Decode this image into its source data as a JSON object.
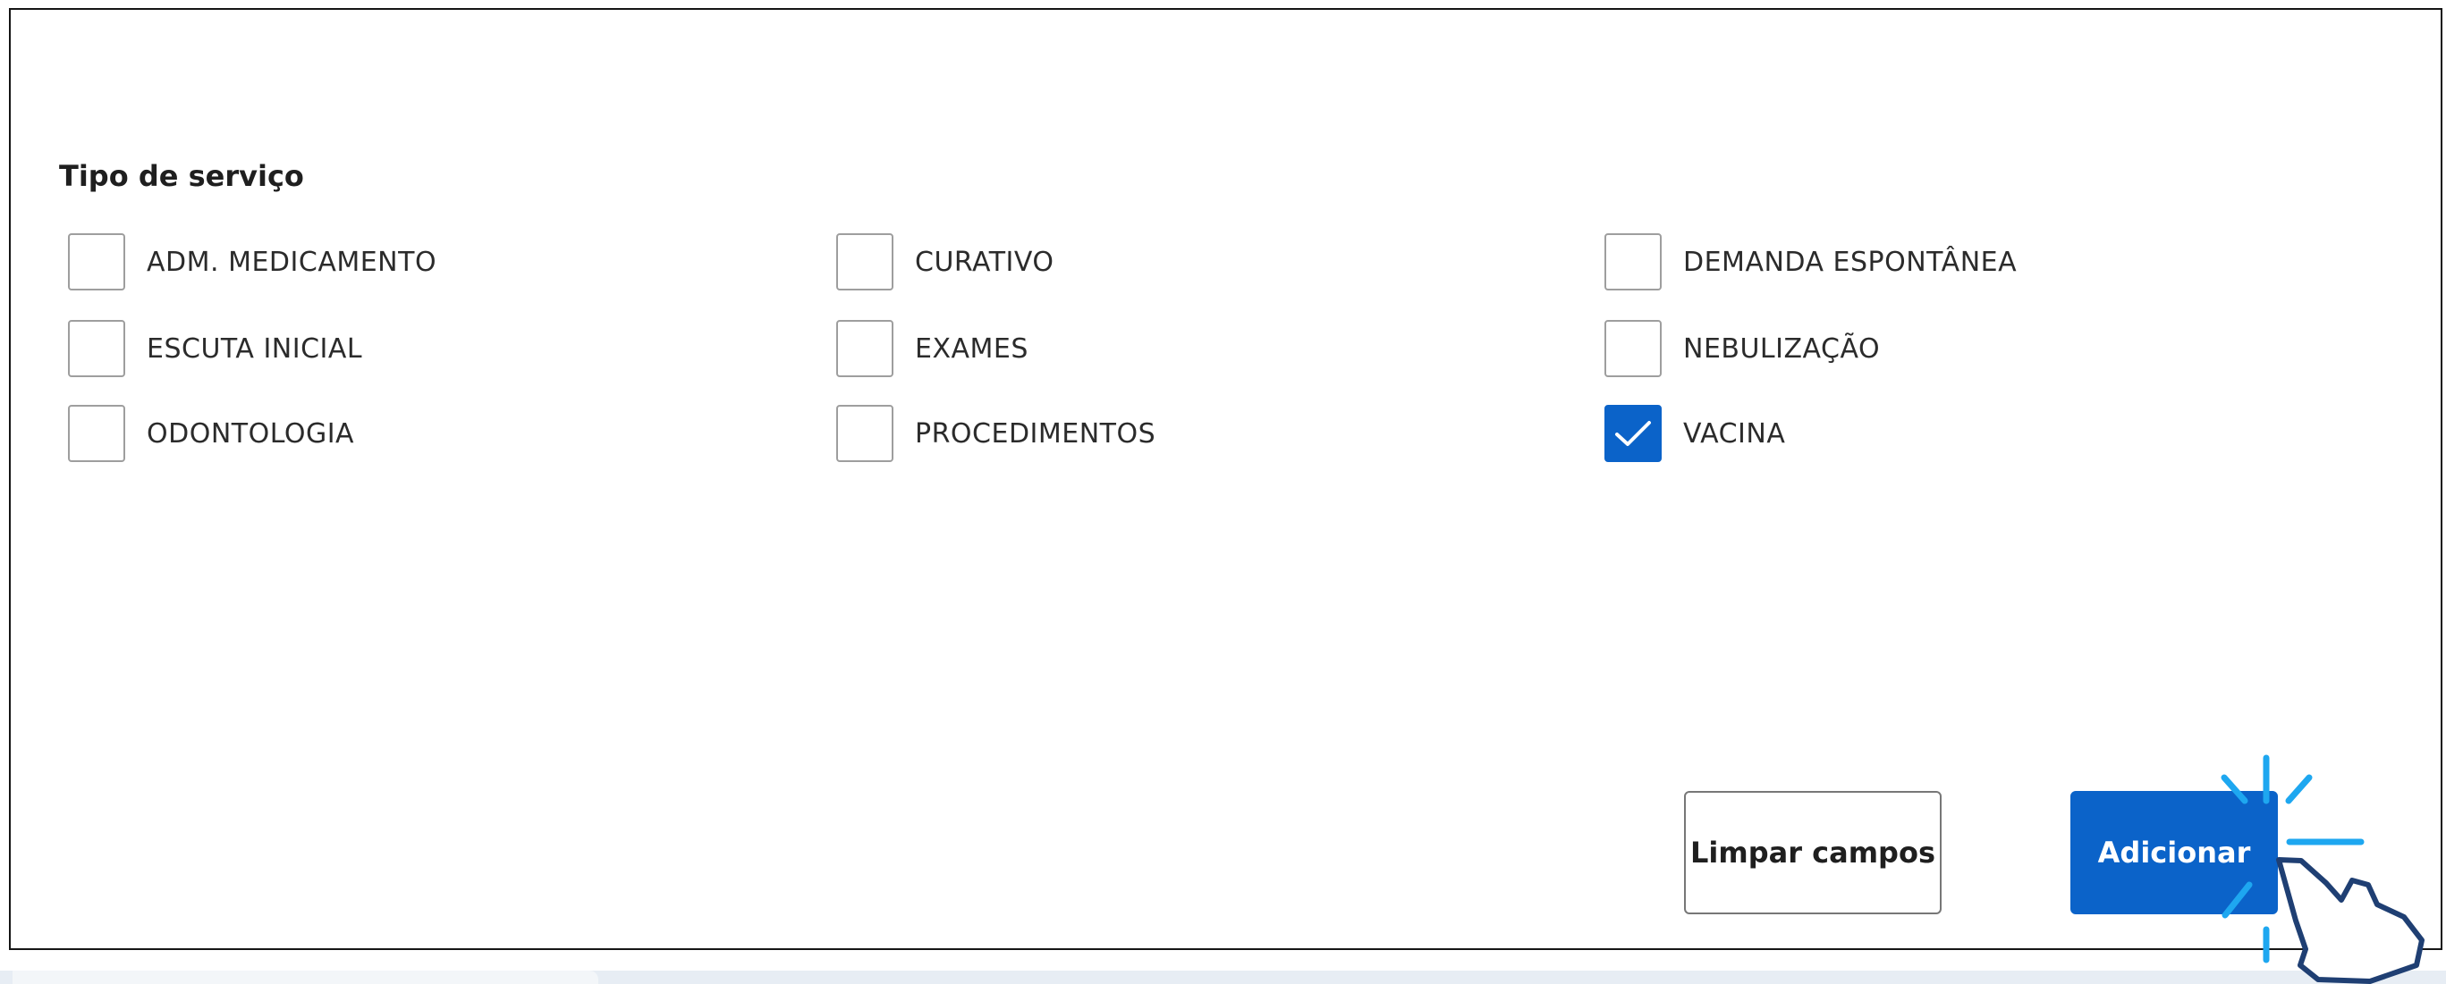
{
  "form": {
    "section_title": "Tipo de serviço",
    "options": [
      {
        "label": "ADM. MEDICAMENTO",
        "checked": false
      },
      {
        "label": "CURATIVO",
        "checked": false
      },
      {
        "label": "DEMANDA ESPONTÂNEA",
        "checked": false
      },
      {
        "label": "ESCUTA INICIAL",
        "checked": false
      },
      {
        "label": "EXAMES",
        "checked": false
      },
      {
        "label": "NEBULIZAÇÃO",
        "checked": false
      },
      {
        "label": "ODONTOLOGIA",
        "checked": false
      },
      {
        "label": "PROCEDIMENTOS",
        "checked": false
      },
      {
        "label": "VACINA",
        "checked": true
      }
    ]
  },
  "actions": {
    "clear_label": "Limpar campos",
    "add_label": "Adicionar"
  },
  "colors": {
    "primary": "#0b63c9",
    "highlight": "#1ea7f0",
    "cursor_outline": "#1f3f73"
  },
  "icons": {
    "checkmark": "check-icon",
    "cursor": "pointer-hand-icon",
    "click_burst": "click-burst-icon"
  }
}
